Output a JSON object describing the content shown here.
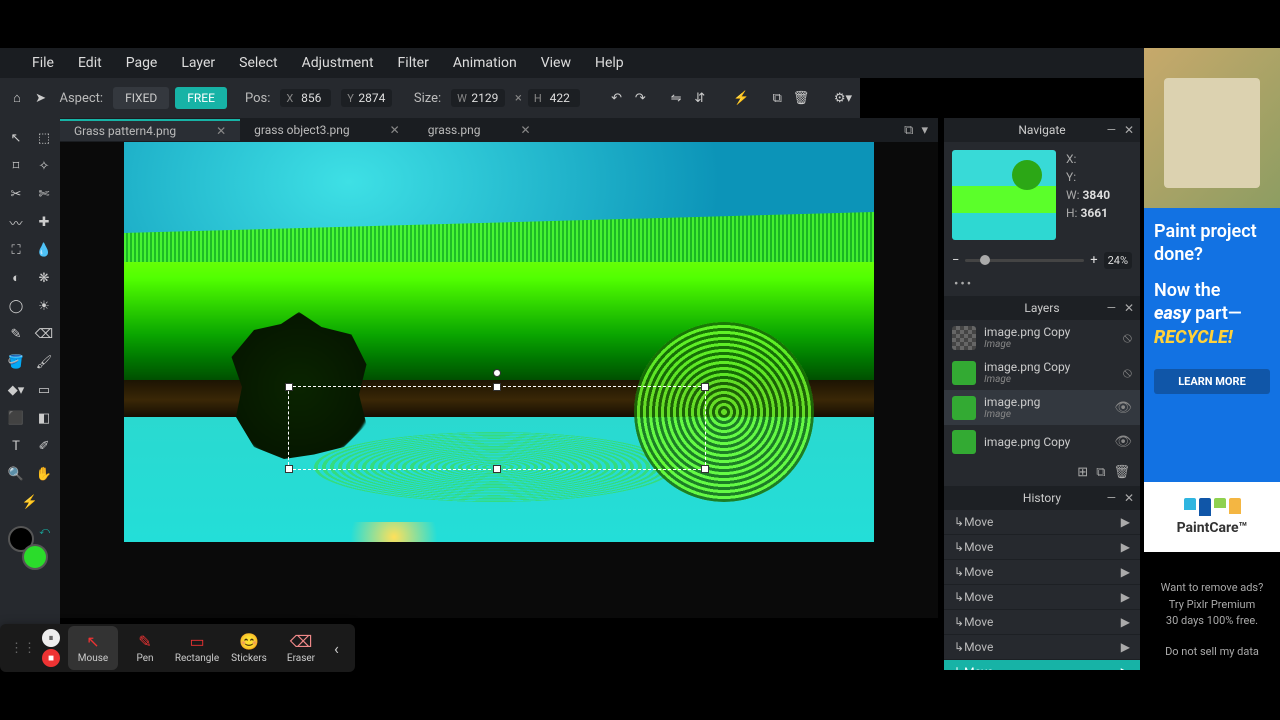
{
  "menubar": [
    "File",
    "Edit",
    "Page",
    "Layer",
    "Select",
    "Adjustment",
    "Filter",
    "Animation",
    "View",
    "Help"
  ],
  "optbar": {
    "aspect_label": "Aspect:",
    "fixed": "FIXED",
    "free": "FREE",
    "pos_label": "Pos:",
    "pos_x": "856",
    "pos_y": "2874",
    "size_label": "Size:",
    "size_w": "2129",
    "size_h": "422",
    "x_sym": "×"
  },
  "tabs": [
    {
      "name": "Grass pattern4.png",
      "active": true
    },
    {
      "name": "grass object3.png",
      "active": false
    },
    {
      "name": "grass.png",
      "active": false
    }
  ],
  "navigate": {
    "title": "Navigate",
    "x": "X:",
    "y": "Y:",
    "w_lbl": "W:",
    "w": "3840",
    "h_lbl": "H:",
    "h": "3661",
    "zoom": "24%"
  },
  "layers": {
    "title": "Layers",
    "items": [
      {
        "name": "image.png Copy",
        "type": "Image",
        "sel": false,
        "thumb": "chk"
      },
      {
        "name": "image.png Copy",
        "type": "Image",
        "sel": false,
        "thumb": "g"
      },
      {
        "name": "image.png",
        "type": "Image",
        "sel": true,
        "thumb": "g"
      },
      {
        "name": "image.png Copy",
        "type": "",
        "sel": false,
        "thumb": "g"
      }
    ]
  },
  "history": {
    "title": "History",
    "items": [
      "Move",
      "Move",
      "Move",
      "Move",
      "Move",
      "Move",
      "Move"
    ],
    "sel_idx": 6
  },
  "recorder": {
    "mouse": "Mouse",
    "pen": "Pen",
    "rect": "Rectangle",
    "stickers": "Stickers",
    "eraser": "Eraser"
  },
  "ad": {
    "l1": "Paint project done?",
    "l2": "Now the",
    "easy": "easy",
    "l3": "part—",
    "recycle": "RECYCLE!",
    "btn": "LEARN MORE",
    "brand": "PaintCare™"
  },
  "under": {
    "l1": "Want to remove ads?",
    "l2": "Try Pixlr Premium",
    "l3": "30 days 100% free.",
    "l4": "Do not sell my data"
  }
}
